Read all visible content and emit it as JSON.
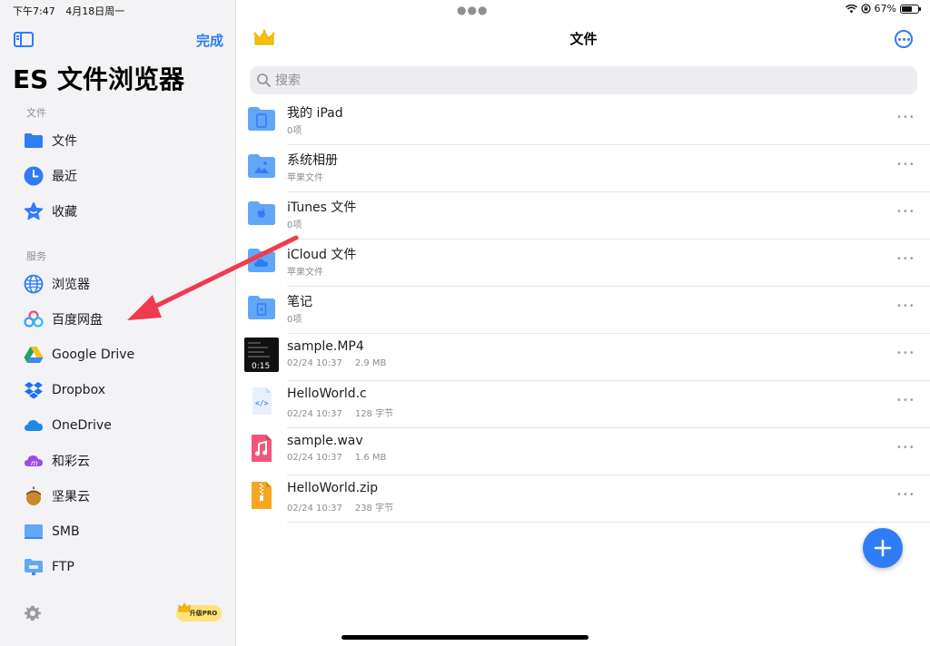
{
  "status_bar": {
    "time": "下午7:47",
    "date": "4月18日周一",
    "battery": "67%",
    "battery_level": 0.67
  },
  "sidebar": {
    "done_label": "完成",
    "app_title": "ES 文件浏览器",
    "section_files": "文件",
    "section_services": "服务",
    "file_items": [
      {
        "label": "文件",
        "icon": "folder-icon"
      },
      {
        "label": "最近",
        "icon": "clock-icon"
      },
      {
        "label": "收藏",
        "icon": "star-icon"
      }
    ],
    "service_items": [
      {
        "label": "浏览器",
        "icon": "globe-icon"
      },
      {
        "label": "百度网盘",
        "icon": "baidu-netdisk-icon"
      },
      {
        "label": "Google Drive",
        "icon": "google-drive-icon"
      },
      {
        "label": "Dropbox",
        "icon": "dropbox-icon"
      },
      {
        "label": "OneDrive",
        "icon": "onedrive-icon"
      },
      {
        "label": "和彩云",
        "icon": "hecaiyun-icon"
      },
      {
        "label": "坚果云",
        "icon": "jianguoyun-icon"
      },
      {
        "label": "SMB",
        "icon": "smb-icon"
      },
      {
        "label": "FTP",
        "icon": "ftp-icon"
      }
    ],
    "upgrade_label": "升级PRO"
  },
  "main": {
    "title": "文件",
    "search_placeholder": "搜索",
    "files": [
      {
        "name": "我的 iPad",
        "meta": [
          "0项"
        ],
        "icon": "folder-ipad-icon"
      },
      {
        "name": "系统相册",
        "meta": [
          "苹果文件"
        ],
        "icon": "folder-photos-icon"
      },
      {
        "name": "iTunes 文件",
        "meta": [
          "0项"
        ],
        "icon": "folder-itunes-icon"
      },
      {
        "name": "iCloud 文件",
        "meta": [
          "苹果文件"
        ],
        "icon": "folder-icloud-icon"
      },
      {
        "name": "笔记",
        "meta": [
          "0项"
        ],
        "icon": "folder-notes-icon"
      },
      {
        "name": "sample.MP4",
        "meta": [
          "02/24 10:37",
          "2.9 MB"
        ],
        "icon": "video-thumbnail",
        "duration": "0:15"
      },
      {
        "name": "HelloWorld.c",
        "meta": [
          "02/24 10:37",
          "128 字节"
        ],
        "icon": "code-file-icon"
      },
      {
        "name": "sample.wav",
        "meta": [
          "02/24 10:37",
          "1.6 MB"
        ],
        "icon": "audio-file-icon"
      },
      {
        "name": "HelloWorld.zip",
        "meta": [
          "02/24 10:37",
          "238 字节"
        ],
        "icon": "zip-file-icon"
      }
    ]
  },
  "colors": {
    "accent": "#2f7cf6",
    "folder": "#62a6f6",
    "annotation_arrow": "#ef3b4f"
  }
}
